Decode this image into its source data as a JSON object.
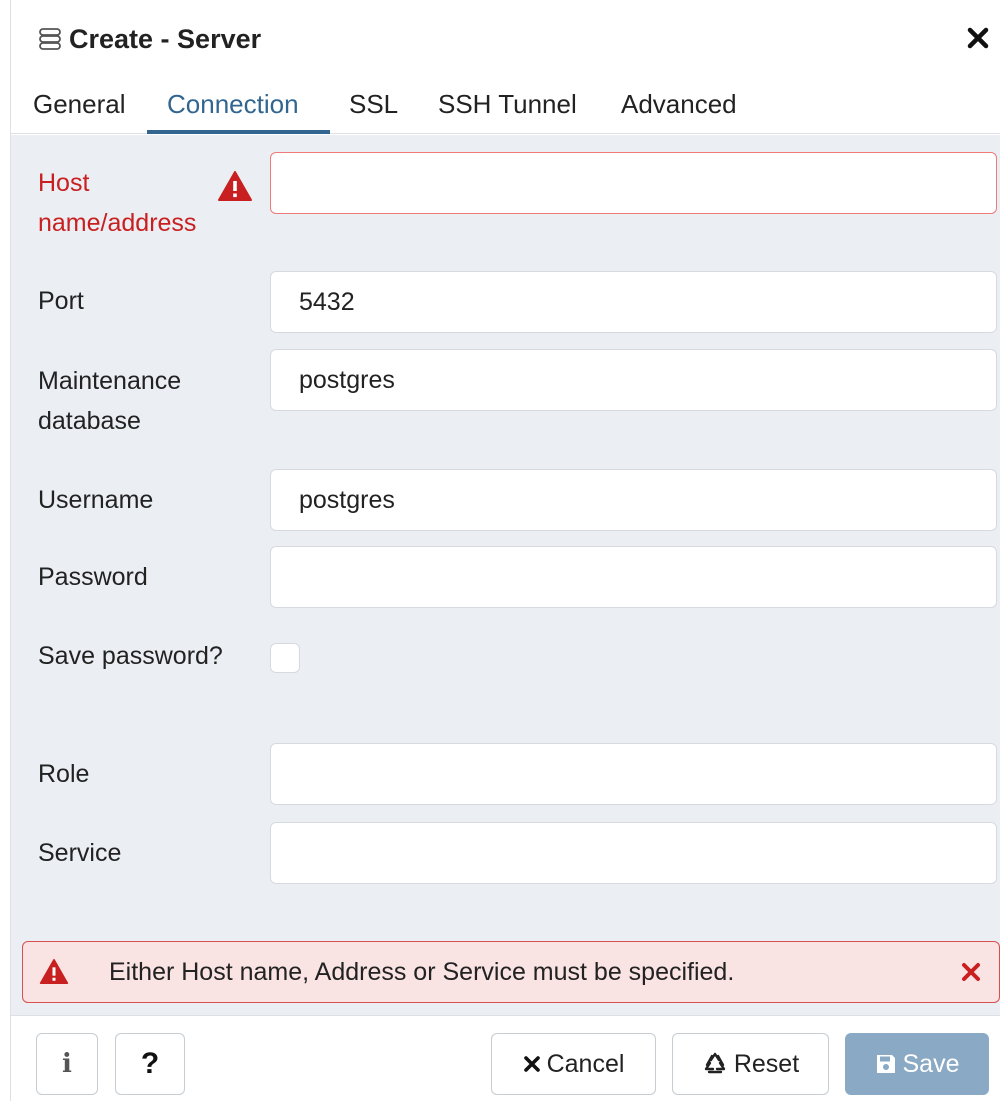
{
  "dialog": {
    "title": "Create - Server"
  },
  "tabs": [
    {
      "label": "General",
      "active": false
    },
    {
      "label": "Connection",
      "active": true
    },
    {
      "label": "SSL",
      "active": false
    },
    {
      "label": "SSH Tunnel",
      "active": false
    },
    {
      "label": "Advanced",
      "active": false
    }
  ],
  "form": {
    "host": {
      "label": "Host name/address",
      "value": "",
      "error": true
    },
    "port": {
      "label": "Port",
      "value": "5432"
    },
    "maintenance_db": {
      "label": "Maintenance database",
      "value": "postgres"
    },
    "username": {
      "label": "Username",
      "value": "postgres"
    },
    "password": {
      "label": "Password",
      "value": ""
    },
    "save_password": {
      "label": "Save password?",
      "checked": false
    },
    "role": {
      "label": "Role",
      "value": ""
    },
    "service": {
      "label": "Service",
      "value": ""
    }
  },
  "alert": {
    "message": "Either Host name, Address or Service must be specified."
  },
  "footer": {
    "info_label": "i",
    "help_label": "?",
    "cancel_label": "Cancel",
    "reset_label": "Reset",
    "save_label": "Save"
  },
  "colors": {
    "accent": "#326690",
    "error": "#c82020",
    "body_bg": "#ebeef3",
    "save_disabled": "#8aa9c4"
  },
  "icons": {
    "title": "server-icon",
    "close": "close-icon",
    "host_warning": "warning-icon",
    "alert": "warning-icon",
    "alert_close": "close-icon",
    "cancel": "close-icon",
    "reset": "recycle-icon",
    "save": "floppy-disk-icon"
  }
}
